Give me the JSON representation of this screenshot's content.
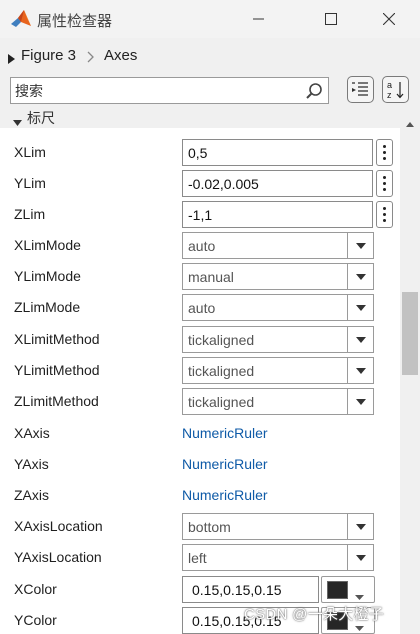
{
  "window": {
    "title": "属性检查器",
    "accent": "#e8641e"
  },
  "breadcrumb": {
    "figure": "Figure 3",
    "axes": "Axes"
  },
  "search": {
    "placeholder": "搜索",
    "value": ""
  },
  "section": {
    "label": "标尺"
  },
  "props": [
    {
      "name": "XLim",
      "value": "0,5",
      "kind": "edit"
    },
    {
      "name": "YLim",
      "value": "-0.02,0.005",
      "kind": "edit"
    },
    {
      "name": "ZLim",
      "value": "-1,1",
      "kind": "edit"
    },
    {
      "name": "XLimMode",
      "value": "auto",
      "kind": "dropdown"
    },
    {
      "name": "YLimMode",
      "value": "manual",
      "kind": "dropdown"
    },
    {
      "name": "ZLimMode",
      "value": "auto",
      "kind": "dropdown"
    },
    {
      "name": "XLimitMethod",
      "value": "tickaligned",
      "kind": "dropdown"
    },
    {
      "name": "YLimitMethod",
      "value": "tickaligned",
      "kind": "dropdown"
    },
    {
      "name": "ZLimitMethod",
      "value": "tickaligned",
      "kind": "dropdown"
    },
    {
      "name": "XAxis",
      "value": "NumericRuler",
      "kind": "link"
    },
    {
      "name": "YAxis",
      "value": "NumericRuler",
      "kind": "link"
    },
    {
      "name": "ZAxis",
      "value": "NumericRuler",
      "kind": "link"
    },
    {
      "name": "XAxisLocation",
      "value": "bottom",
      "kind": "dropdown"
    },
    {
      "name": "YAxisLocation",
      "value": "left",
      "kind": "dropdown"
    },
    {
      "name": "XColor",
      "value": "0.15,0.15,0.15",
      "kind": "color",
      "swatch": "#262626"
    },
    {
      "name": "YColor",
      "value": "0.15,0.15,0.15",
      "kind": "color",
      "swatch": "#262626"
    }
  ],
  "watermark": "CSDN @一朵大橙子"
}
